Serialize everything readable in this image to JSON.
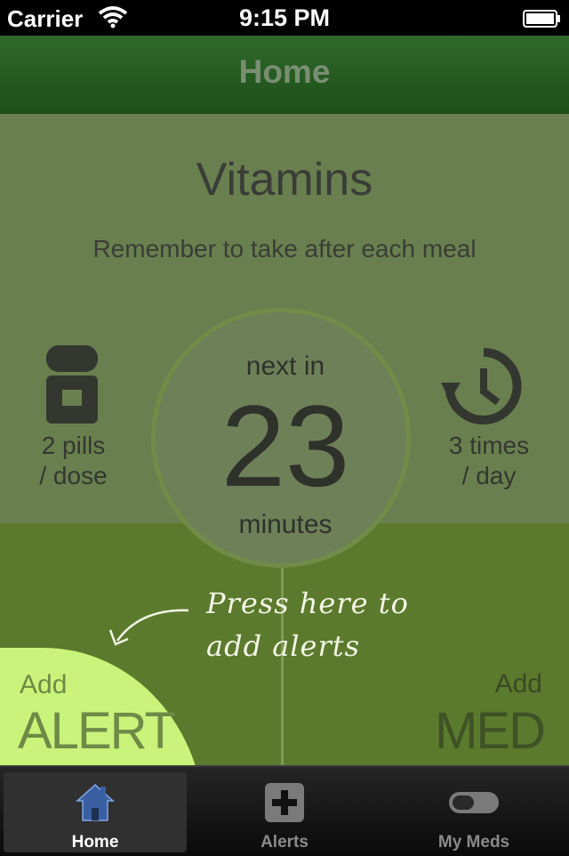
{
  "status": {
    "carrier": "Carrier",
    "time": "9:15 PM"
  },
  "nav": {
    "title": "Home"
  },
  "medication": {
    "name": "Vitamins",
    "note": "Remember to take after each meal",
    "dose_line1": "2 pills",
    "dose_line2": "/ dose",
    "freq_line1": "3 times",
    "freq_line2": "/ day",
    "next_in_label": "next in",
    "minutes_value": "23",
    "minutes_label": "minutes"
  },
  "hint": {
    "line1": "Press here to",
    "line2": "add alerts"
  },
  "actions": {
    "alert_small": "Add",
    "alert_big": "ALERT",
    "med_small": "Add",
    "med_big": "MED"
  },
  "tabs": [
    {
      "label": "Home",
      "icon": "home-icon"
    },
    {
      "label": "Alerts",
      "icon": "plus-icon"
    },
    {
      "label": "My Meds",
      "icon": "pill-capsule-icon"
    }
  ],
  "colors": {
    "navbar": "#2f6a2a",
    "accent": "#c9f37a",
    "panel": "#6a7f4f",
    "bottom": "#5b7a2d"
  }
}
